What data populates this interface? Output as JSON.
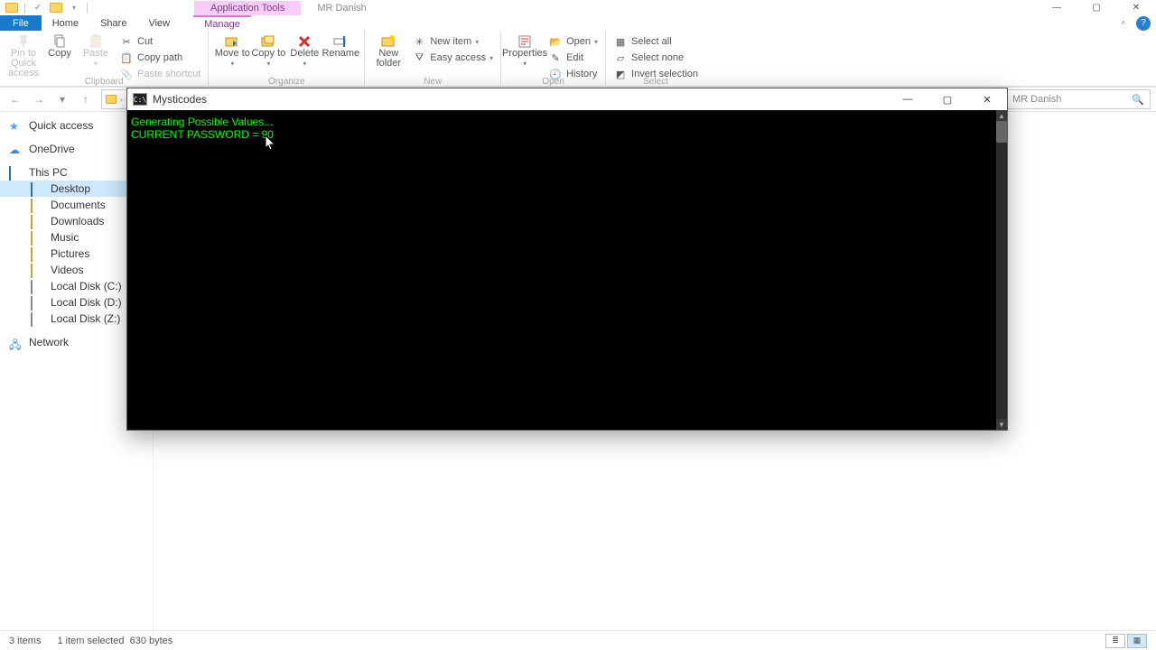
{
  "window": {
    "context_tools_label": "Application Tools",
    "title": "MR Danish"
  },
  "tabs": {
    "file": "File",
    "home": "Home",
    "share": "Share",
    "view": "View",
    "manage": "Manage"
  },
  "ribbon": {
    "pin": "Pin to Quick access",
    "copy": "Copy",
    "paste": "Paste",
    "cut": "Cut",
    "copy_path": "Copy path",
    "paste_shortcut": "Paste shortcut",
    "group_clipboard": "Clipboard",
    "move_to": "Move to",
    "copy_to": "Copy to",
    "delete": "Delete",
    "rename": "Rename",
    "group_organize": "Organize",
    "new_folder": "New folder",
    "new_item": "New item",
    "easy_access": "Easy access",
    "group_new": "New",
    "properties": "Properties",
    "open": "Open",
    "edit": "Edit",
    "history": "History",
    "group_open": "Open",
    "select_all": "Select all",
    "select_none": "Select none",
    "invert_selection": "Invert selection",
    "group_select": "Select"
  },
  "search": {
    "placeholder": "MR Danish"
  },
  "tree": {
    "quick_access": "Quick access",
    "onedrive": "OneDrive",
    "this_pc": "This PC",
    "desktop": "Desktop",
    "documents": "Documents",
    "downloads": "Downloads",
    "music": "Music",
    "pictures": "Pictures",
    "videos": "Videos",
    "drive_c": "Local Disk (C:)",
    "drive_d": "Local Disk (D:)",
    "drive_z": "Local Disk (Z:)",
    "network": "Network"
  },
  "status": {
    "count": "3 items",
    "selected": "1 item selected",
    "size": "630 bytes"
  },
  "console": {
    "title": "Mysticodes",
    "line1": "Generating Possible Values...",
    "line2": "CURRENT PASSWORD = 90"
  }
}
